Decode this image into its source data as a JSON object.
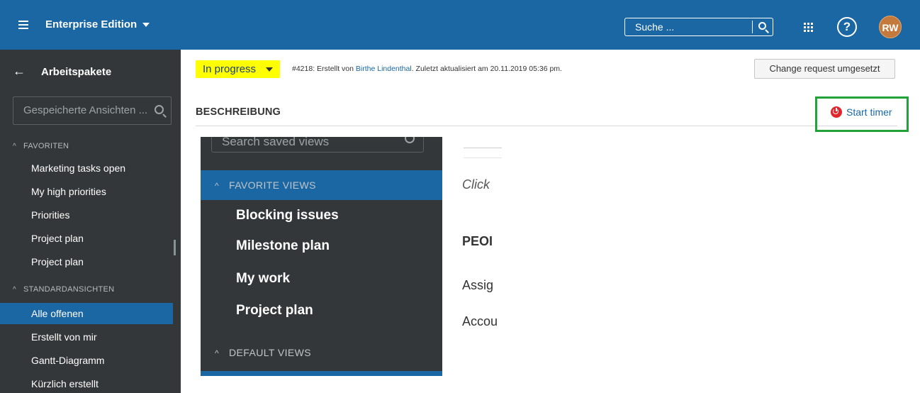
{
  "header": {
    "edition_label": "Enterprise Edition",
    "search_placeholder": "Suche ...",
    "help_label": "?",
    "avatar_initials": "RW",
    "color": "#1a67a3"
  },
  "sidebar": {
    "back_label": "Arbeitspakete",
    "search_placeholder": "Gespeicherte Ansichten ...",
    "favorites_title": "FAVORITEN",
    "favorites": [
      {
        "label": "Marketing tasks open"
      },
      {
        "label": "My high priorities"
      },
      {
        "label": "Priorities"
      },
      {
        "label": "Project plan"
      },
      {
        "label": "Project plan"
      }
    ],
    "standard_title": "STANDARDANSICHTEN",
    "standard": [
      {
        "label": "Alle offenen",
        "active": true
      },
      {
        "label": "Erstellt von mir"
      },
      {
        "label": "Gantt-Diagramm"
      },
      {
        "label": "Kürzlich erstellt"
      }
    ]
  },
  "work_package": {
    "status": "In progress",
    "status_color": "#ffff00",
    "meta_prefix": "#4218: Erstellt von",
    "author": "Birthe Lindenthal",
    "meta_suffix": ". Zuletzt aktualisiert am 20.11.2019 05:36 pm.",
    "action_button": "Change request umgesetzt",
    "section_title": "BESCHREIBUNG",
    "timer_label": "Start timer"
  },
  "embedded": {
    "search_placeholder": "Search saved views",
    "favorites_title": "FAVORITE VIEWS",
    "items": [
      "Blocking issues",
      "Milestone plan",
      "My work",
      "Project plan"
    ],
    "default_title": "DEFAULT VIEWS"
  },
  "fragments": {
    "click": "Click",
    "people": "PEOI",
    "assignee": "Assig",
    "accountable": "Accou"
  }
}
